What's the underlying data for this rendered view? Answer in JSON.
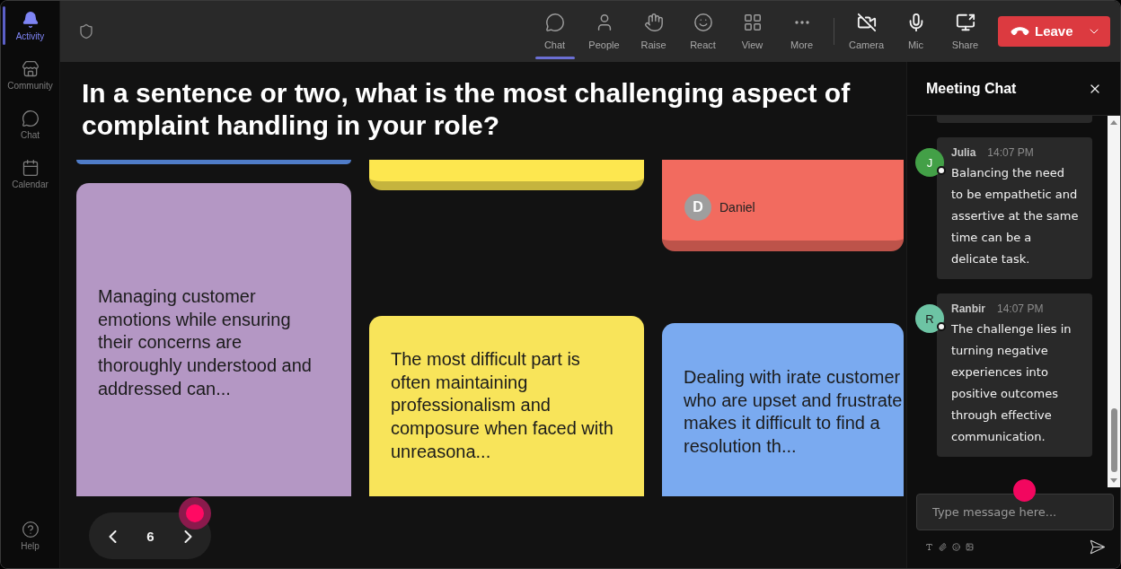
{
  "sidebar": {
    "items": [
      {
        "label": "Activity",
        "selected": true
      },
      {
        "label": "Community",
        "selected": false
      },
      {
        "label": "Chat",
        "selected": false
      },
      {
        "label": "Calendar",
        "selected": false
      }
    ],
    "help": {
      "label": "Help"
    }
  },
  "toolbar": {
    "buttons": [
      {
        "label": "Chat",
        "selected": true
      },
      {
        "label": "People",
        "selected": false
      },
      {
        "label": "Raise",
        "selected": false
      },
      {
        "label": "React",
        "selected": false
      },
      {
        "label": "View",
        "selected": false
      },
      {
        "label": "More",
        "selected": false
      }
    ],
    "devices": [
      {
        "kind": "camera",
        "label": "Camera",
        "on": false
      },
      {
        "kind": "mic",
        "label": "Mic",
        "on": true
      },
      {
        "kind": "share",
        "label": "Share"
      }
    ],
    "leave_button": {
      "label": "Leave"
    }
  },
  "question": "In a sentence or two, what is the most challenging aspect of complaint handling in your role?",
  "board": {
    "columns": [
      {
        "cards": [
          {
            "kind": "cut_off",
            "color": "#4f7cc8"
          },
          {
            "kind": "text",
            "color": "#b497c4",
            "text": "Managing customer emotions while ensuring their concerns are thoroughly understood and addressed can..."
          }
        ]
      },
      {
        "cards": [
          {
            "kind": "cut_off",
            "color": "#fde74f"
          },
          {
            "kind": "text",
            "color": "#f8e45a",
            "text": "The most difficult part is often maintaining professionalism and composure when faced with unreasona..."
          }
        ]
      },
      {
        "cards": [
          {
            "kind": "author",
            "color": "#f26b5f",
            "author": "Daniel",
            "initial": "D"
          },
          {
            "kind": "text",
            "color": "#7aaaf0",
            "text": "Dealing with irate customer who are upset and frustrate makes it difficult to find a resolution th..."
          }
        ]
      }
    ]
  },
  "pager": {
    "page": "6"
  },
  "chat": {
    "title": "Meeting Chat",
    "messages": [
      {
        "kind": "cut_off"
      },
      {
        "kind": "message",
        "author": "Julia",
        "initial": "J",
        "color": "#43a047",
        "time": "14:07 PM",
        "text": "Balancing the need to be empathetic and assertive at the same time can be a delicate task."
      },
      {
        "kind": "message",
        "author": "Ranbir",
        "initial": "R",
        "color": "#6dc4a4",
        "time": "14:07 PM",
        "text": "The challenge lies in turning negative experiences into positive outcomes through effective communication."
      }
    ],
    "input": {
      "placeholder": "Type message here..."
    }
  }
}
